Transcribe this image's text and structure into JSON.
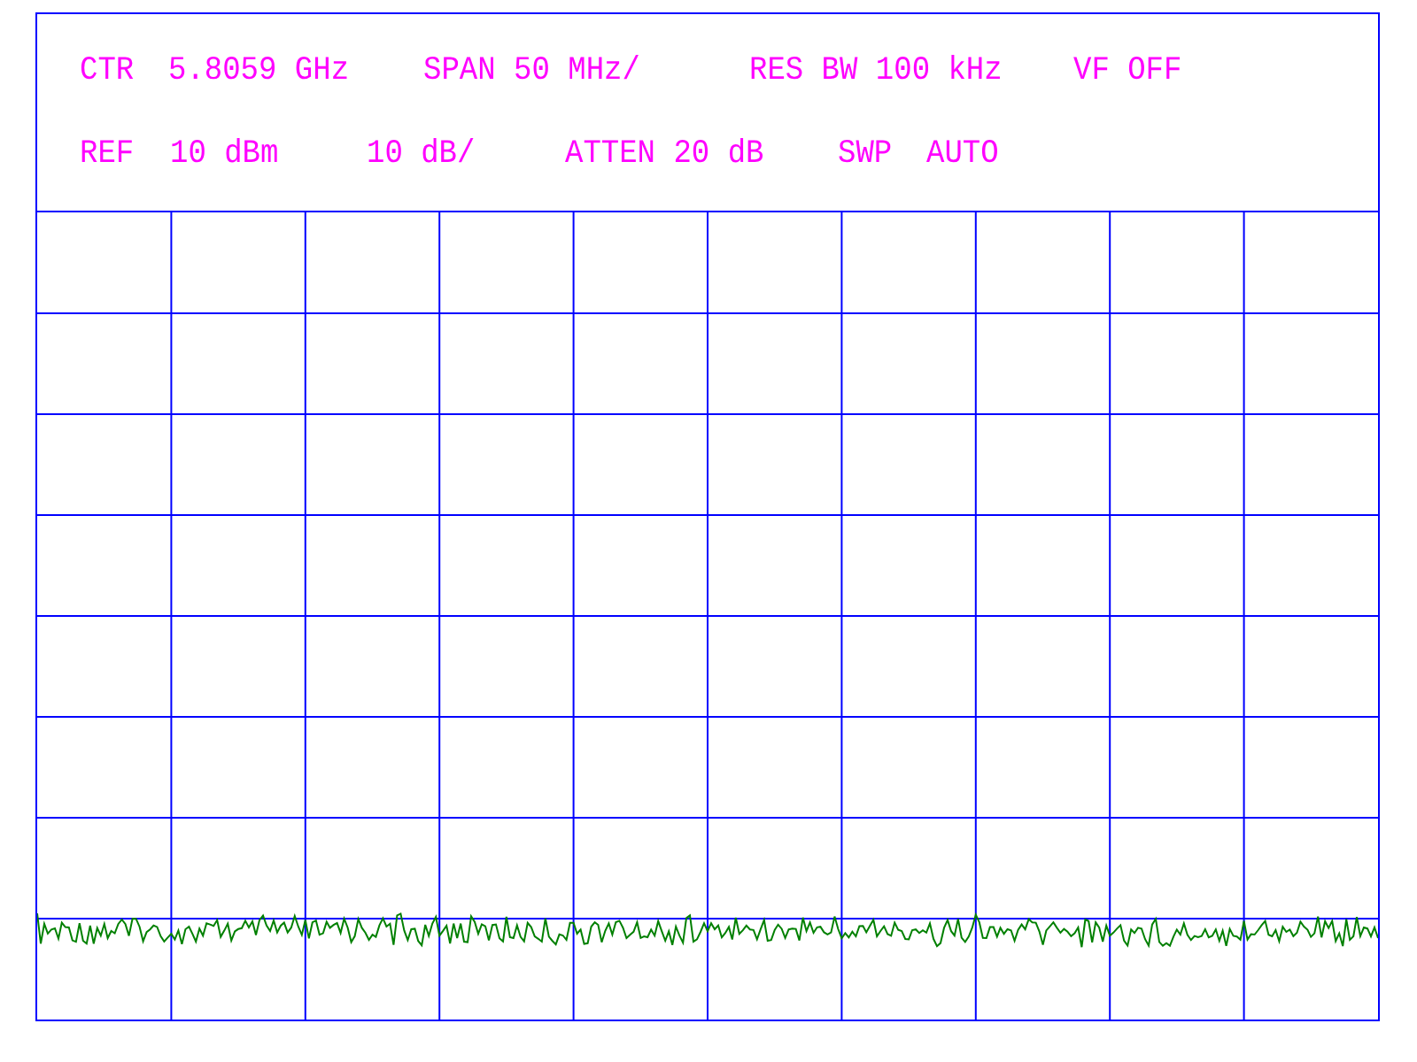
{
  "header": {
    "top_line": [
      "CTR",
      "5.8059 GHz",
      "SPAN 50 MHz/",
      "RES BW 100 kHz",
      "VF OFF"
    ],
    "bottom_line": [
      "REF",
      "10 dBm",
      "10 dB/",
      "ATTEN 20 dB",
      "SWP",
      "AUTO"
    ]
  },
  "display": {
    "trace": {
      "kind": "noise"
    }
  }
}
